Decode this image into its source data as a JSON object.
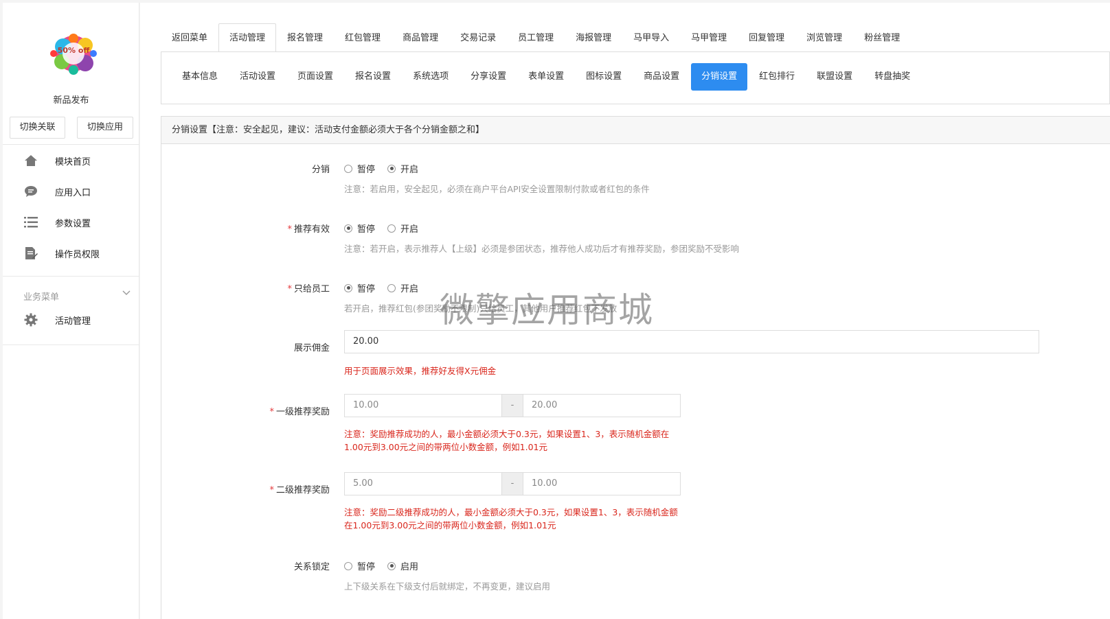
{
  "sidebar": {
    "app_name": "新品发布",
    "logo_text": "50% off",
    "switch_link_label": "切换关联",
    "switch_app_label": "切换应用",
    "nav": [
      {
        "label": "模块首页",
        "icon": "home-icon"
      },
      {
        "label": "应用入口",
        "icon": "chat-icon"
      },
      {
        "label": "参数设置",
        "icon": "list-icon"
      },
      {
        "label": "操作员权限",
        "icon": "document-edit-icon"
      }
    ],
    "section_title": "业务菜单",
    "section_items": [
      {
        "label": "活动管理",
        "icon": "gear-icon"
      }
    ]
  },
  "tabs": [
    "返回菜单",
    "活动管理",
    "报名管理",
    "红包管理",
    "商品管理",
    "交易记录",
    "员工管理",
    "海报管理",
    "马甲导入",
    "马甲管理",
    "回复管理",
    "浏览管理",
    "粉丝管理"
  ],
  "active_tab": 1,
  "subtabs": [
    "基本信息",
    "活动设置",
    "页面设置",
    "报名设置",
    "系统选项",
    "分享设置",
    "表单设置",
    "图标设置",
    "商品设置",
    "分销设置",
    "红包排行",
    "联盟设置",
    "转盘抽奖"
  ],
  "active_subtab": 9,
  "panel": {
    "title": "分销设置【注意：安全起见，建议：活动支付金额必须大于各个分销金额之和】"
  },
  "form": {
    "distribution": {
      "label": "分销",
      "options": [
        "暂停",
        "开启"
      ],
      "selected": 1,
      "hint": "注意：若启用，安全起见，必须在商户平台API安全设置限制付款或者红包的条件"
    },
    "referral_valid": {
      "label": "推荐有效",
      "options": [
        "暂停",
        "开启"
      ],
      "selected": 0,
      "hint": "注意：若开启，表示推荐人【上级】必须是参团状态，推荐他人成功后才有推荐奖励，参团奖励不受影响"
    },
    "staff_only": {
      "label": "只给员工",
      "options": [
        "暂停",
        "开启"
      ],
      "selected": 0,
      "hint": "若开启，推荐红包(参团奖励不限制)只给员工，其他用户推荐红包不发放"
    },
    "display_commission": {
      "label": "展示佣金",
      "value": "20.00",
      "hint": "用于页面展示效果，推荐好友得X元佣金"
    },
    "level1_reward": {
      "label": "一级推荐奖励",
      "min": "10.00",
      "separator": "-",
      "max": "20.00",
      "hint": "注意：奖励推荐成功的人，最小金额必须大于0.3元，如果设置1、3，表示随机金额在1.00元到3.00元之间的带两位小数金额，例如1.01元"
    },
    "level2_reward": {
      "label": "二级推荐奖励",
      "min": "5.00",
      "separator": "-",
      "max": "10.00",
      "hint": "注意：奖励二级推荐成功的人，最小金额必须大于0.3元，如果设置1、3，表示随机金额在1.00元到3.00元之间的带两位小数金额，例如1.01元"
    },
    "relation_lock": {
      "label": "关系锁定",
      "options": [
        "暂停",
        "启用"
      ],
      "selected": 1,
      "hint": "上下级关系在下级支付后就绑定，不再变更，建议启用"
    }
  },
  "watermark": "微擎应用商城",
  "colors": {
    "accent": "#2d8cf0",
    "required": "#e4393c",
    "hint_red": "#d9261c"
  }
}
